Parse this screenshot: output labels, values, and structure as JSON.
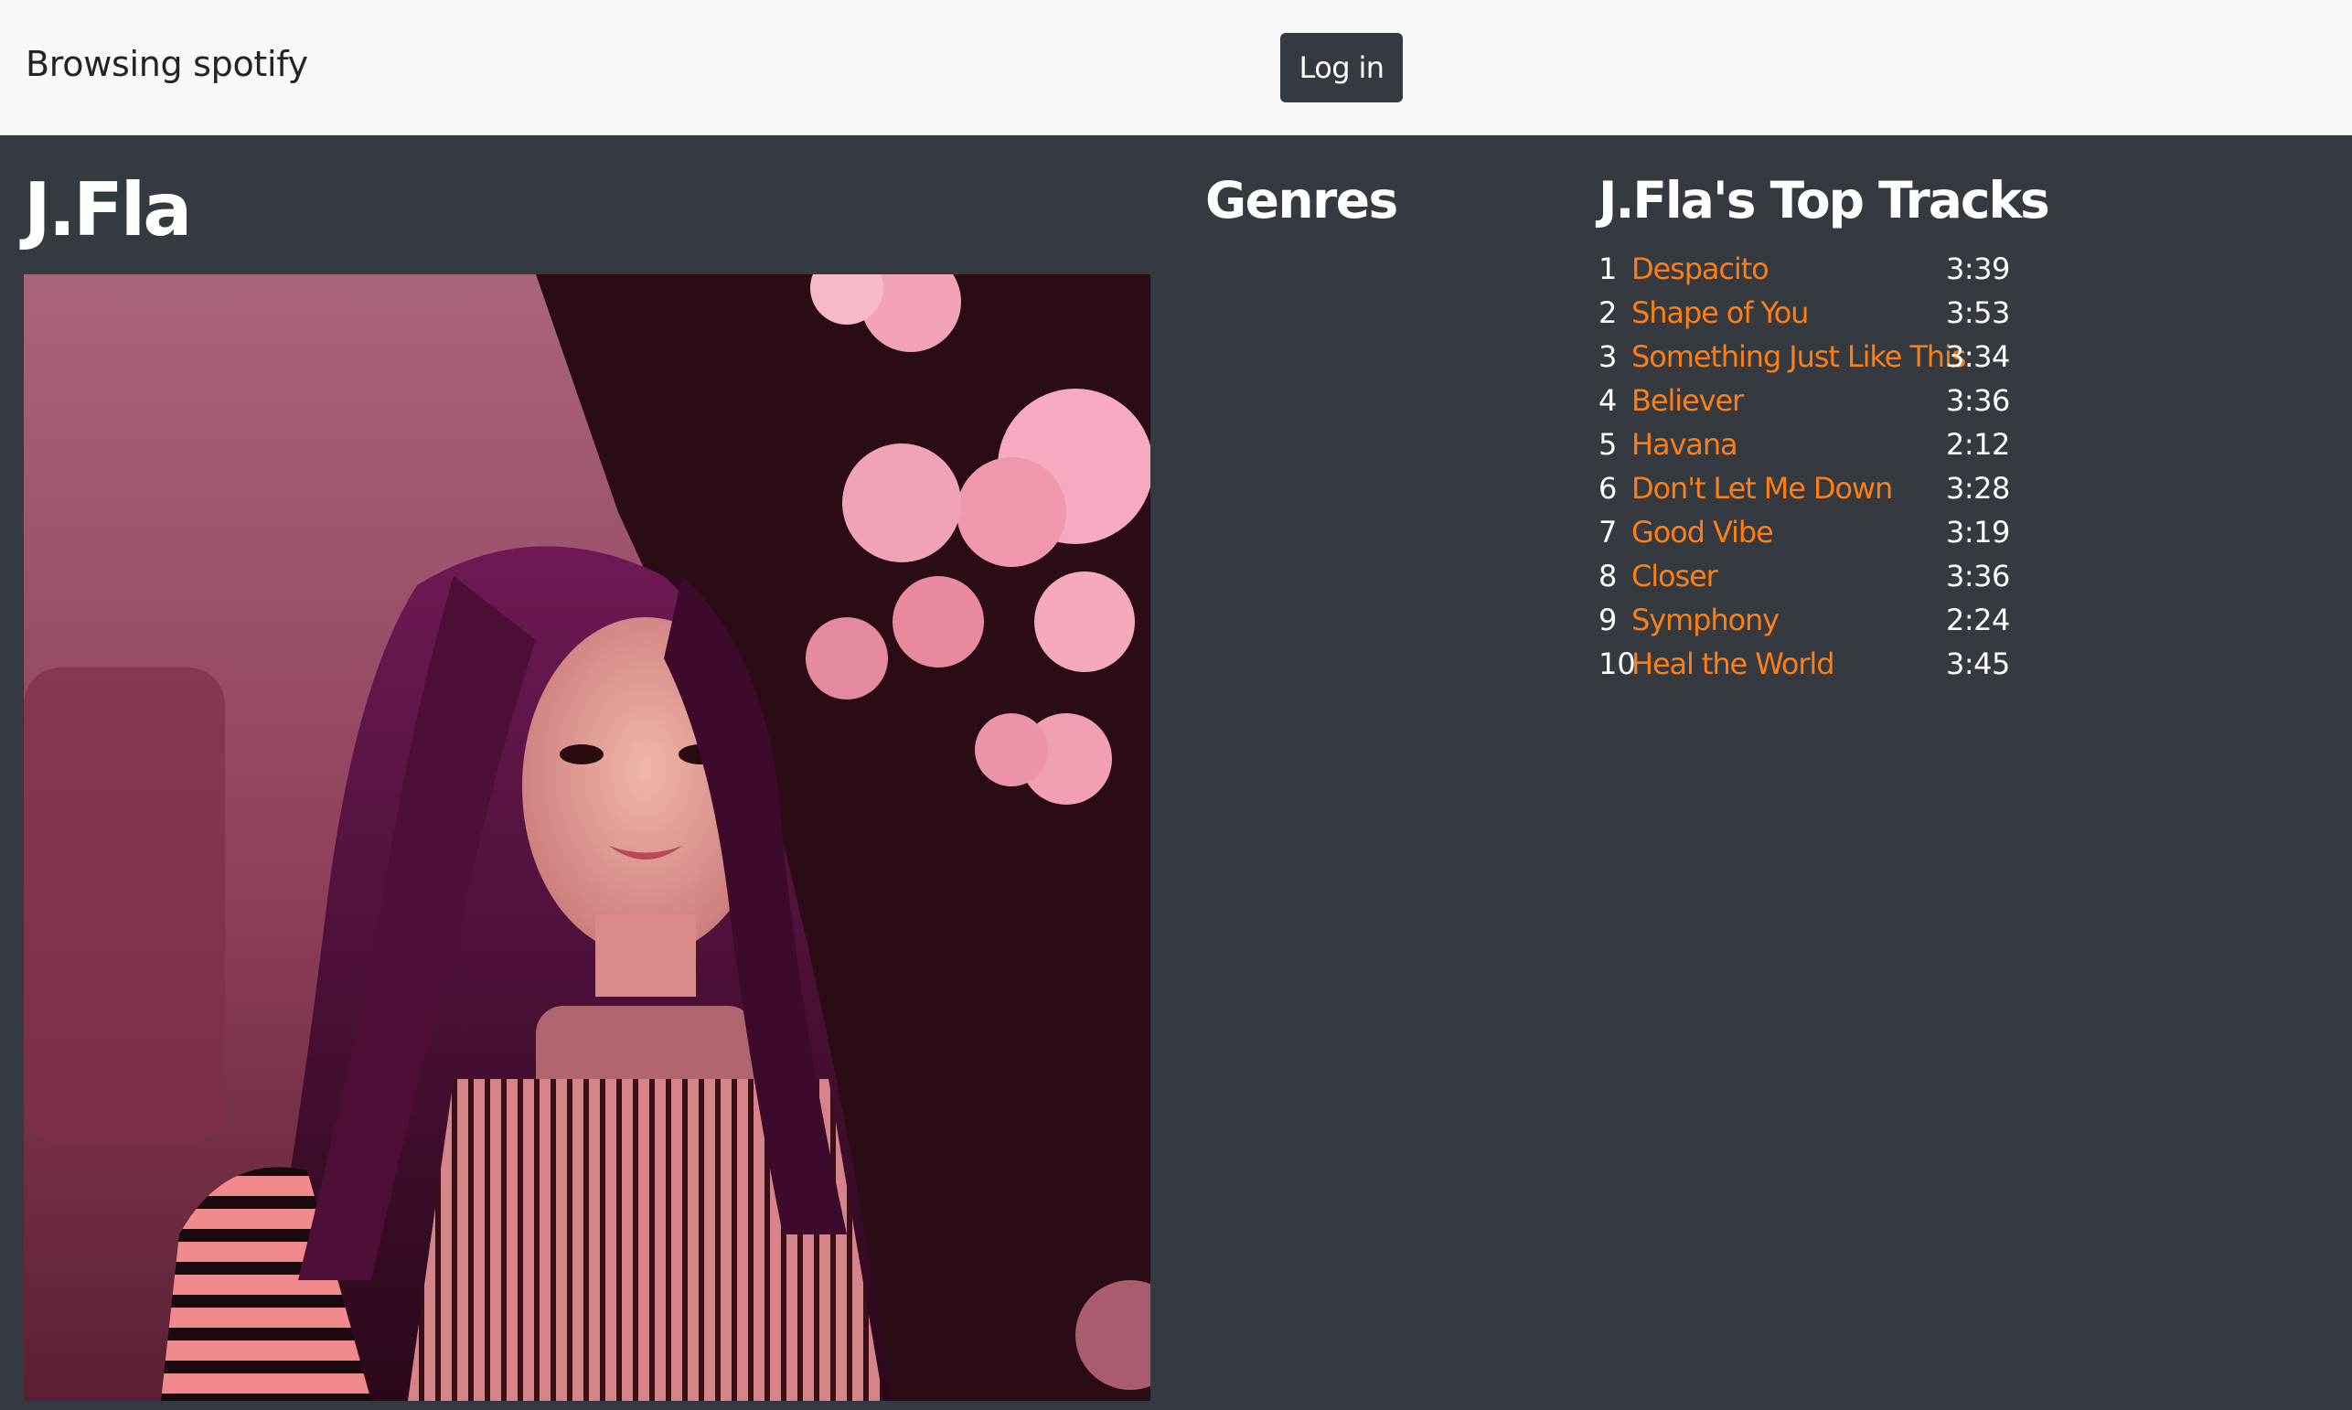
{
  "navbar": {
    "brand": "Browsing spotify",
    "login_label": "Log in"
  },
  "artist": {
    "name": "J.Fla",
    "image_icon": "artist-portrait"
  },
  "genres": {
    "heading": "Genres"
  },
  "top_tracks": {
    "heading": "J.Fla's Top Tracks",
    "tracks": [
      {
        "number": "1",
        "title": "Despacito",
        "duration": "3:39"
      },
      {
        "number": "2",
        "title": "Shape of You",
        "duration": "3:53"
      },
      {
        "number": "3",
        "title": "Something Just Like This",
        "duration": "3:34"
      },
      {
        "number": "4",
        "title": "Believer",
        "duration": "3:36"
      },
      {
        "number": "5",
        "title": "Havana",
        "duration": "2:12"
      },
      {
        "number": "6",
        "title": "Don't Let Me Down",
        "duration": "3:28"
      },
      {
        "number": "7",
        "title": "Good Vibe",
        "duration": "3:19"
      },
      {
        "number": "8",
        "title": "Closer",
        "duration": "3:36"
      },
      {
        "number": "9",
        "title": "Symphony",
        "duration": "2:24"
      },
      {
        "number": "10",
        "title": "Heal the World",
        "duration": "3:45"
      }
    ]
  },
  "colors": {
    "navbar_bg": "#f8f9fa",
    "page_bg": "#343a40",
    "link": "#fd7e14",
    "text": "#ffffff"
  }
}
